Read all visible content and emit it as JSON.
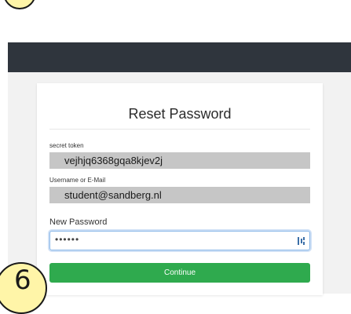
{
  "window": {
    "badge_top_number": "",
    "badge_bottom_number": "6"
  },
  "form": {
    "title": "Reset Password",
    "secret_token": {
      "label": "secret token",
      "value": "vejhjq6368gqa8kjev2j"
    },
    "username": {
      "label": "Username or E-Mail",
      "value": "student@sandberg.nl"
    },
    "new_password": {
      "label": "New Password",
      "value": "••••••"
    },
    "submit_label": "Continue"
  },
  "colors": {
    "navbar": "#2f353d",
    "page_background": "#f2f2f2",
    "filled_field": "#c6c6c6",
    "button": "#2faa4e",
    "focus_border": "#8ab8e8",
    "badge_fill": "#fff5a8"
  },
  "icons": {
    "password_field": "password-manager-icon"
  }
}
